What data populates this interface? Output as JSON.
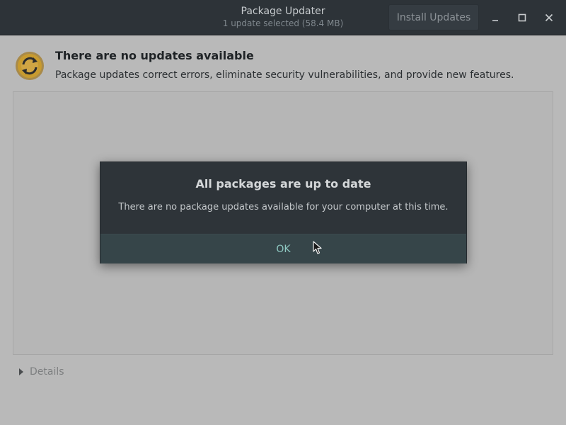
{
  "window": {
    "title": "Package Updater",
    "subtitle": "1 update selected (58.4 MB)",
    "install_button": "Install Updates",
    "minimize_icon": "minimize-icon",
    "maximize_icon": "maximize-icon",
    "close_icon": "close-icon"
  },
  "main": {
    "icon": "update-sync-icon",
    "heading": "There are no updates available",
    "description": "Package updates correct errors, eliminate security vulnerabilities, and provide new features.",
    "details_label": "Details"
  },
  "dialog": {
    "title": "All packages are up to date",
    "message": "There are no package updates available for your computer at this time.",
    "ok_label": "OK"
  },
  "colors": {
    "accent": "#8fc9c2",
    "headerbar": "#2d3338",
    "icon_orange": "#e8a317"
  }
}
